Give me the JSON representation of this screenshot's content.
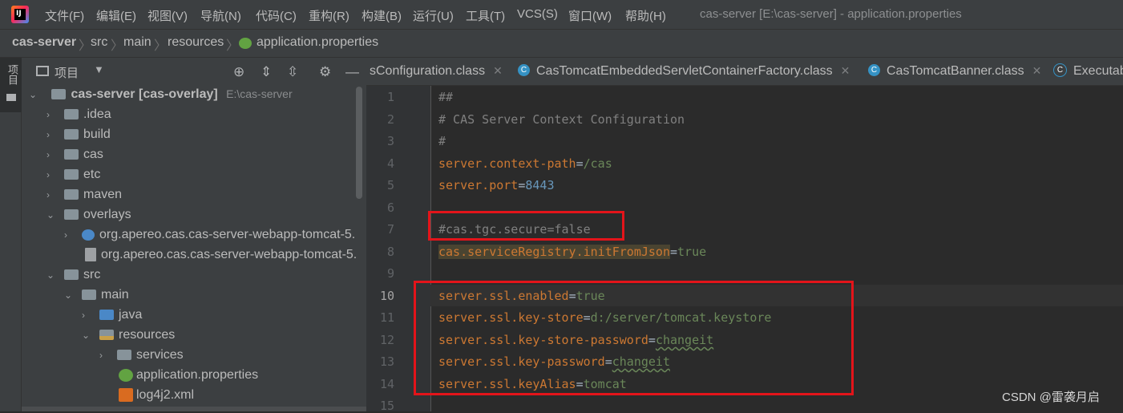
{
  "menu": {
    "items": [
      "文件(F)",
      "编辑(E)",
      "视图(V)",
      "导航(N)",
      "代码(C)",
      "重构(R)",
      "构建(B)",
      "运行(U)",
      "工具(T)",
      "VCS(S)",
      "窗口(W)",
      "帮助(H)"
    ],
    "window_title": "cas-server [E:\\cas-server] - application.properties"
  },
  "breadcrumb": [
    "cas-server",
    "src",
    "main",
    "resources",
    "application.properties"
  ],
  "tool_strip": {
    "project_label": "项目"
  },
  "project_panel": {
    "title": "项目",
    "toolbar_icons": [
      "locate-icon",
      "expand-all-icon",
      "collapse-all-icon",
      "settings-icon",
      "hide-icon"
    ],
    "root": {
      "name": "cas-server",
      "module": "[cas-overlay]",
      "path": "E:\\cas-server"
    },
    "tree": [
      {
        "label": ".idea"
      },
      {
        "label": "build"
      },
      {
        "label": "cas"
      },
      {
        "label": "etc"
      },
      {
        "label": "maven"
      },
      {
        "label": "overlays"
      },
      {
        "label": "org.apereo.cas.cas-server-webapp-tomcat-5."
      },
      {
        "label": "org.apereo.cas.cas-server-webapp-tomcat-5."
      },
      {
        "label": "src"
      },
      {
        "label": "main"
      },
      {
        "label": "java"
      },
      {
        "label": "resources"
      },
      {
        "label": "services"
      },
      {
        "label": "application.properties"
      },
      {
        "label": "log4j2.xml"
      }
    ]
  },
  "tabs": [
    {
      "label": "sConfiguration.class"
    },
    {
      "label": "CasTomcatEmbeddedServletContainerFactory.class"
    },
    {
      "label": "CasTomcatBanner.class"
    },
    {
      "label": "Executab"
    }
  ],
  "editor": {
    "current_line": 10,
    "line_numbers": [
      "1",
      "2",
      "3",
      "4",
      "5",
      "6",
      "7",
      "8",
      "9",
      "10",
      "11",
      "12",
      "13",
      "14",
      "15"
    ],
    "lines": {
      "l1": "##",
      "l2": "# CAS Server Context Configuration",
      "l3": "#",
      "l4_key": "server.context-path",
      "l4_val": "/cas",
      "l5_key": "server.port",
      "l5_val": "8443",
      "l7": "#cas.tgc.secure=false",
      "l8_key": "cas.serviceRegistry.initFromJson",
      "l8_val": "true",
      "l10_key": "server.ssl.enabled",
      "l10_val": "true",
      "l11_key": "server.ssl.key-store",
      "l11_val": "d:/server/tomcat.keystore",
      "l12_key": "server.ssl.key-store-password",
      "l12_val": "changeit",
      "l13_key": "server.ssl.key-password",
      "l13_val": "changeit",
      "l14_key": "server.ssl.keyAlias",
      "l14_val": "tomcat",
      "eq": "="
    }
  },
  "watermark": "CSDN @雷袭月启",
  "colors": {
    "annotation_red": "#e3141a",
    "key_orange": "#cc7832",
    "value_green": "#6a8759",
    "number_blue": "#6897bb"
  }
}
